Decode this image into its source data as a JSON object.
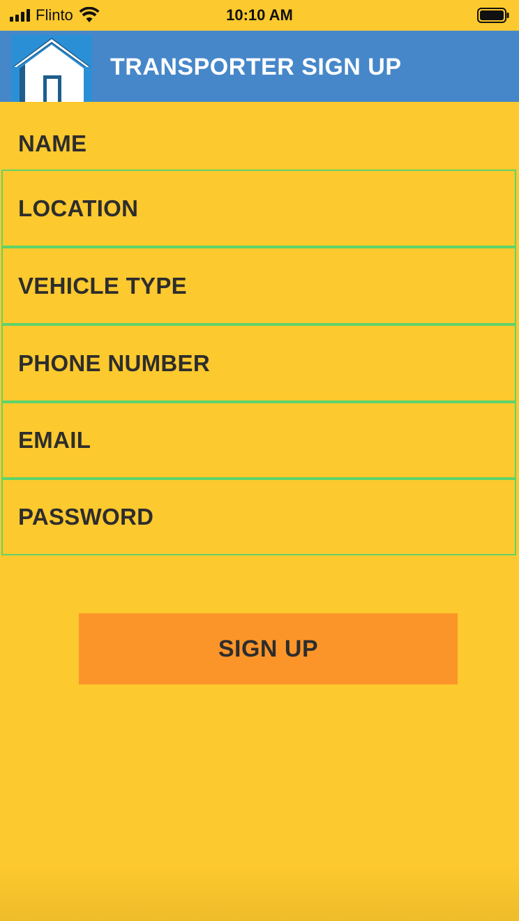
{
  "status_bar": {
    "carrier": "Flinto",
    "time": "10:10 AM",
    "icons": [
      "signal-icon",
      "wifi-icon",
      "battery-icon"
    ]
  },
  "header": {
    "logo_icon": "home-icon",
    "title": "TRANSPORTER SIGN UP",
    "background": "#4687c9"
  },
  "form": {
    "fields": [
      {
        "key": "name",
        "label": "NAME"
      },
      {
        "key": "location",
        "label": "LOCATION"
      },
      {
        "key": "vehicle_type",
        "label": "VEHICLE TYPE"
      },
      {
        "key": "phone_number",
        "label": "PHONE NUMBER"
      },
      {
        "key": "email",
        "label": "EMAIL"
      },
      {
        "key": "password",
        "label": "PASSWORD"
      }
    ],
    "field_border_color": "#5fd36a",
    "submit_label": "SIGN UP",
    "submit_color": "#fc9529"
  },
  "colors": {
    "page_background": "#fcc92e",
    "text": "#2d2d2d"
  }
}
